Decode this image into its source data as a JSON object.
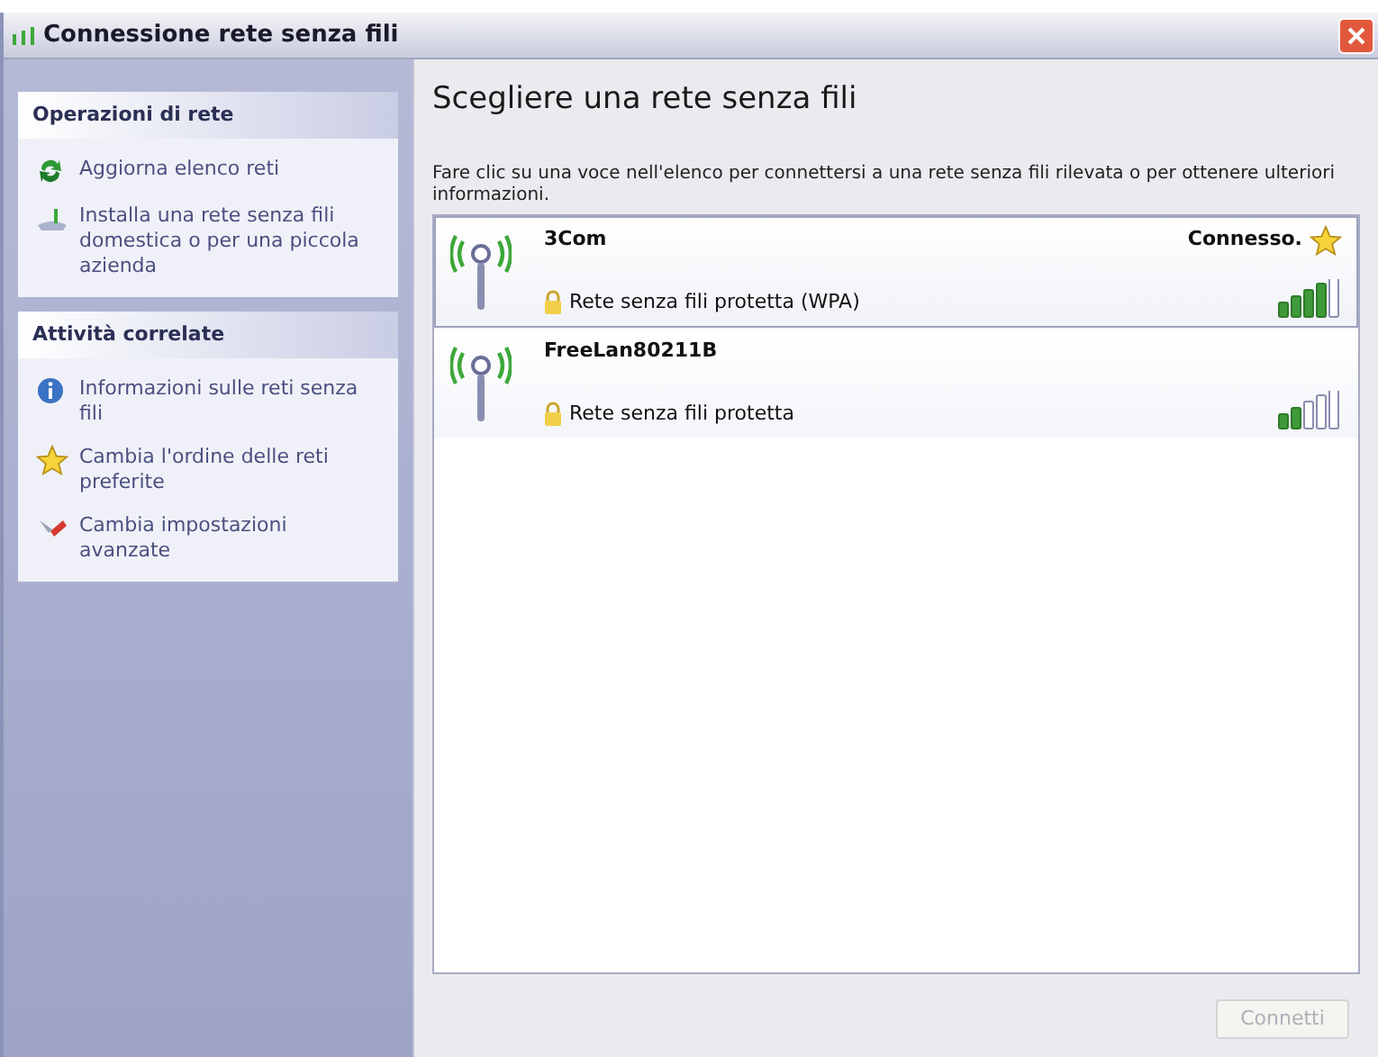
{
  "window": {
    "title": "Connessione rete senza fili"
  },
  "sidebar": {
    "sections": [
      {
        "title": "Operazioni di rete",
        "items": [
          {
            "kind": "refresh",
            "label": "Aggiorna elenco reti"
          },
          {
            "kind": "setup",
            "label": "Installa una rete senza fili domestica o per una piccola azienda"
          }
        ]
      },
      {
        "title": "Attività correlate",
        "items": [
          {
            "kind": "info",
            "label": "Informazioni sulle reti senza fili"
          },
          {
            "kind": "star",
            "label": "Cambia l'ordine delle reti preferite"
          },
          {
            "kind": "settings",
            "label": "Cambia impostazioni avanzate"
          }
        ]
      }
    ]
  },
  "heading": "Scegliere una rete senza fili",
  "instructions": "Fare clic su una voce nell'elenco per connettersi a una rete senza fili rilevata o per ottenere ulteriori informazioni.",
  "networks": [
    {
      "name": "3Com",
      "security": "Rete senza fili protetta (WPA)",
      "status": "Connesso.",
      "connected": true,
      "selected": true,
      "signal_icon": {
        "kind": "strong"
      }
    },
    {
      "name": "FreeLan80211B",
      "security": "Rete senza fili protetta",
      "connected": false,
      "selected": false,
      "signal_icon": {
        "kind": "weak"
      }
    }
  ],
  "connect_button": {
    "label": "Connetti",
    "disabled": true
  }
}
